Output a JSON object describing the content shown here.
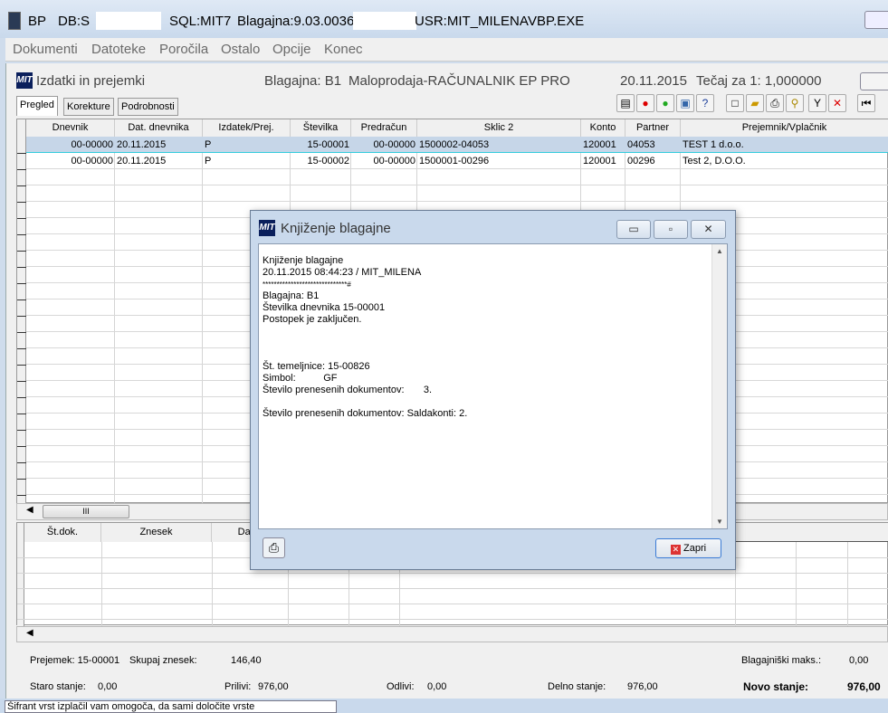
{
  "window": {
    "app": "BP",
    "db": "DB:S",
    "sql": "SQL:MIT7",
    "blagajna_ver": "Blagajna:9.03.0036",
    "user": "USR:MIT_MILENA",
    "exe": "VBP.EXE"
  },
  "menu": [
    "Dokumenti",
    "Datoteke",
    "Poročila",
    "Ostalo",
    "Opcije",
    "Konec"
  ],
  "child": {
    "logo": "MIT",
    "title": "Izdatki in prejemki",
    "blagajna": "Blagajna: B1",
    "opis": "Maloprodaja-RAČUNALNIK EP PRO",
    "date": "20.11.2015",
    "tecaj": "Tečaj za 1: 1,000000"
  },
  "tabs": [
    "Pregled",
    "Korekture",
    "Podrobnosti"
  ],
  "toolbar": [
    "report-icon",
    "delete-icon",
    "add-icon",
    "export-icon",
    "help-icon",
    "new-document-icon",
    "open-folder-icon",
    "print-icon",
    "find-icon",
    "filter-icon",
    "cancel-icon",
    "first-record-icon"
  ],
  "grid": {
    "columns": [
      "Dnevnik",
      "Dat. dnevnika",
      "Izdatek/Prej.",
      "Številka",
      "Predračun",
      "Sklic 2",
      "Konto",
      "Partner",
      "Prejemnik/Vplačnik"
    ],
    "rows": [
      [
        "00-00000",
        "20.11.2015",
        "P",
        "15-00001",
        "00-00000",
        "1500002-04053",
        "120001",
        "04053",
        "TEST 1 d.o.o."
      ],
      [
        "00-00000",
        "20.11.2015",
        "P",
        "15-00002",
        "00-00000",
        "1500001-00296",
        "120001",
        "00296",
        "Test 2, D.O.O."
      ]
    ],
    "selected_row": 0
  },
  "detail_grid": {
    "columns": [
      "Št.dok.",
      "Znesek",
      "Dat.v"
    ]
  },
  "summary": {
    "prejemek": "Prejemek: 15-00001",
    "skupaj_label": "Skupaj znesek:",
    "skupaj": "146,40",
    "maks_label": "Blagajniški maks.:",
    "maks": "0,00",
    "staro_label": "Staro stanje:",
    "staro": "0,00",
    "prilivi_label": "Prilivi:",
    "prilivi": "976,00",
    "odlivi_label": "Odlivi:",
    "odlivi": "0,00",
    "delno_label": "Delno stanje:",
    "delno": "976,00",
    "novo_label": "Novo stanje:",
    "novo": "976,00"
  },
  "taskbar_text": "Šifrant vrst izplačil vam omogoča, da sami določite vrste",
  "dialog": {
    "logo": "MIT",
    "title": "Knjiženje blagajne",
    "lines": [
      "Knjiženje blagajne",
      "20.11.2015 08:44:23 / MIT_MILENA",
      "******************************#",
      "Blagajna: B1",
      "Številka dnevnika 15-00001",
      "Postopek je zaključen.",
      "",
      "",
      "",
      "Št. temeljnice: 15-00826",
      "Simbol:          GF",
      "Število prenesenih dokumentov:       3.",
      "",
      "Število prenesenih dokumentov: Saldakonti: 2."
    ],
    "close_label": "Zapri"
  }
}
